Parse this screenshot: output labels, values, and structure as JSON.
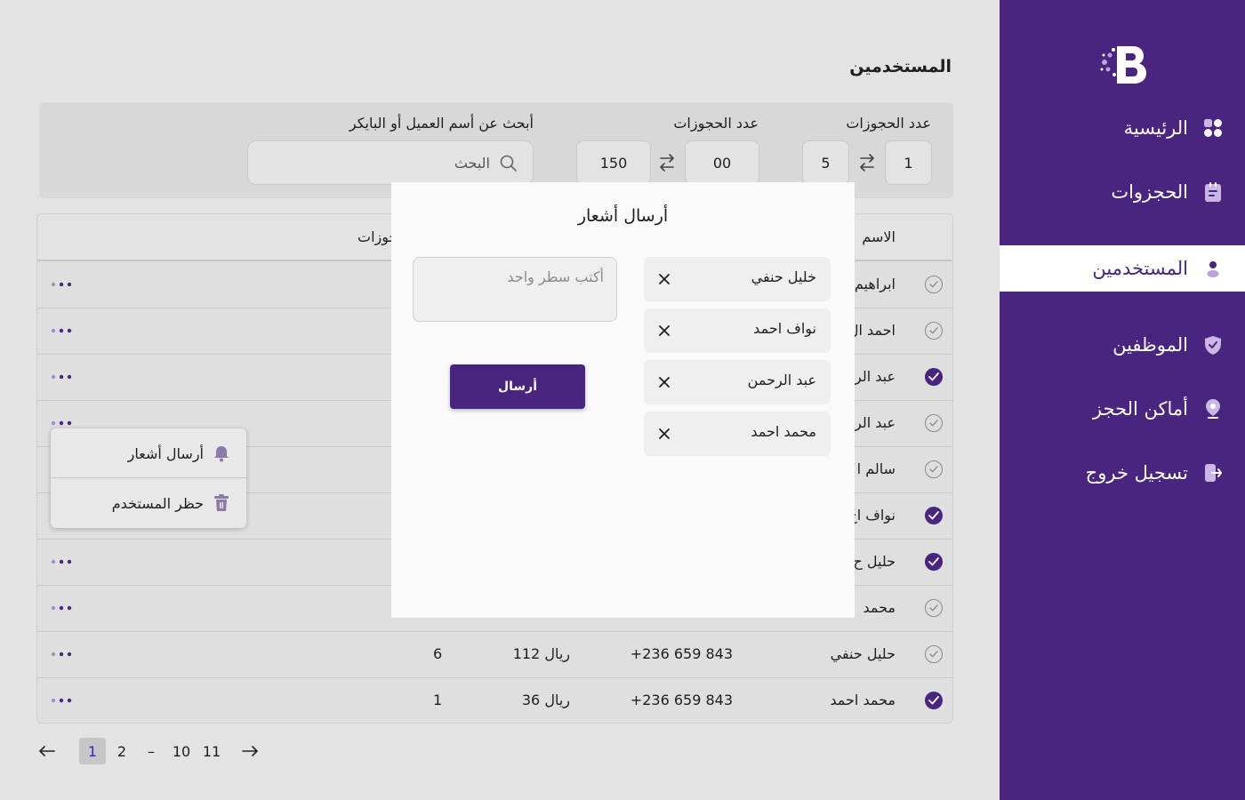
{
  "sidebar": {
    "logo_icon": "brand-b-logo",
    "items": [
      {
        "label": "الرئيسية",
        "icon": "dashboard-icon",
        "active": false
      },
      {
        "label": "الحجزوات",
        "icon": "clipboard-icon",
        "active": false
      },
      {
        "label": "المستخدمين",
        "icon": "user-icon",
        "active": true
      },
      {
        "label": "الموظفين",
        "icon": "shield-icon",
        "active": false
      },
      {
        "label": "أماكن الحجز",
        "icon": "location-icon",
        "active": false
      },
      {
        "label": "تسجيل خروج",
        "icon": "logout-icon",
        "active": false
      }
    ]
  },
  "page": {
    "title": "المستخدمين"
  },
  "filters": {
    "bookings_a": {
      "label": "عدد الحجوزات",
      "from": "1",
      "to": "5"
    },
    "bookings_b": {
      "label": "عدد الحجوزات",
      "from": "00",
      "to": "150"
    },
    "search": {
      "label": "أبحث عن أسم العميل أو البايكر",
      "placeholder": "البحث"
    }
  },
  "table": {
    "headers": {
      "name": "الاسم",
      "bookings": "جوزات"
    },
    "rows": [
      {
        "name": "ابراهيم",
        "phone": "",
        "amount": "",
        "bookings": "",
        "checked": false
      },
      {
        "name": "احمد ال",
        "phone": "",
        "amount": "",
        "bookings": "",
        "checked": false
      },
      {
        "name": "عبد الر",
        "phone": "",
        "amount": "",
        "bookings": "",
        "checked": true
      },
      {
        "name": "عبد الر",
        "phone": "",
        "amount": "",
        "bookings": "",
        "checked": false
      },
      {
        "name": "سالم ا",
        "phone": "",
        "amount": "",
        "bookings": "",
        "checked": false
      },
      {
        "name": "نواف اح",
        "phone": "",
        "amount": "",
        "bookings": "",
        "checked": true
      },
      {
        "name": "حليل ح",
        "phone": "",
        "amount": "",
        "bookings": "",
        "checked": true
      },
      {
        "name": "محمد",
        "phone": "",
        "amount": "",
        "bookings": "",
        "checked": false
      },
      {
        "name": "حليل حنفي",
        "phone": "+236 659 843",
        "amount": "112 ريال",
        "bookings": "6",
        "checked": false
      },
      {
        "name": "محمد احمد",
        "phone": "+236 659 843",
        "amount": "36 ريال",
        "bookings": "1",
        "checked": true
      }
    ]
  },
  "context_menu": {
    "items": [
      {
        "label": "أرسال أشعار",
        "icon": "bell-icon"
      },
      {
        "label": "حظر المستخدم",
        "icon": "trash-icon"
      }
    ]
  },
  "pagination": {
    "prev_icon": "arrow-left-icon",
    "next_icon": "arrow-right-icon",
    "pages": [
      "1",
      "2",
      "–",
      "10",
      "11"
    ],
    "current": "1"
  },
  "modal": {
    "title": "أرسال أشعار",
    "recipients": [
      "خليل حنفي",
      "نواف احمد",
      "عبد الرحمن",
      "محمد احمد"
    ],
    "message_placeholder": "أكتب سطر واحد",
    "send_label": "أرسال"
  },
  "colors": {
    "primary": "#4a2580",
    "background": "#e3e3e3",
    "panel": "#d8d8d8",
    "modal": "#fafafa"
  }
}
